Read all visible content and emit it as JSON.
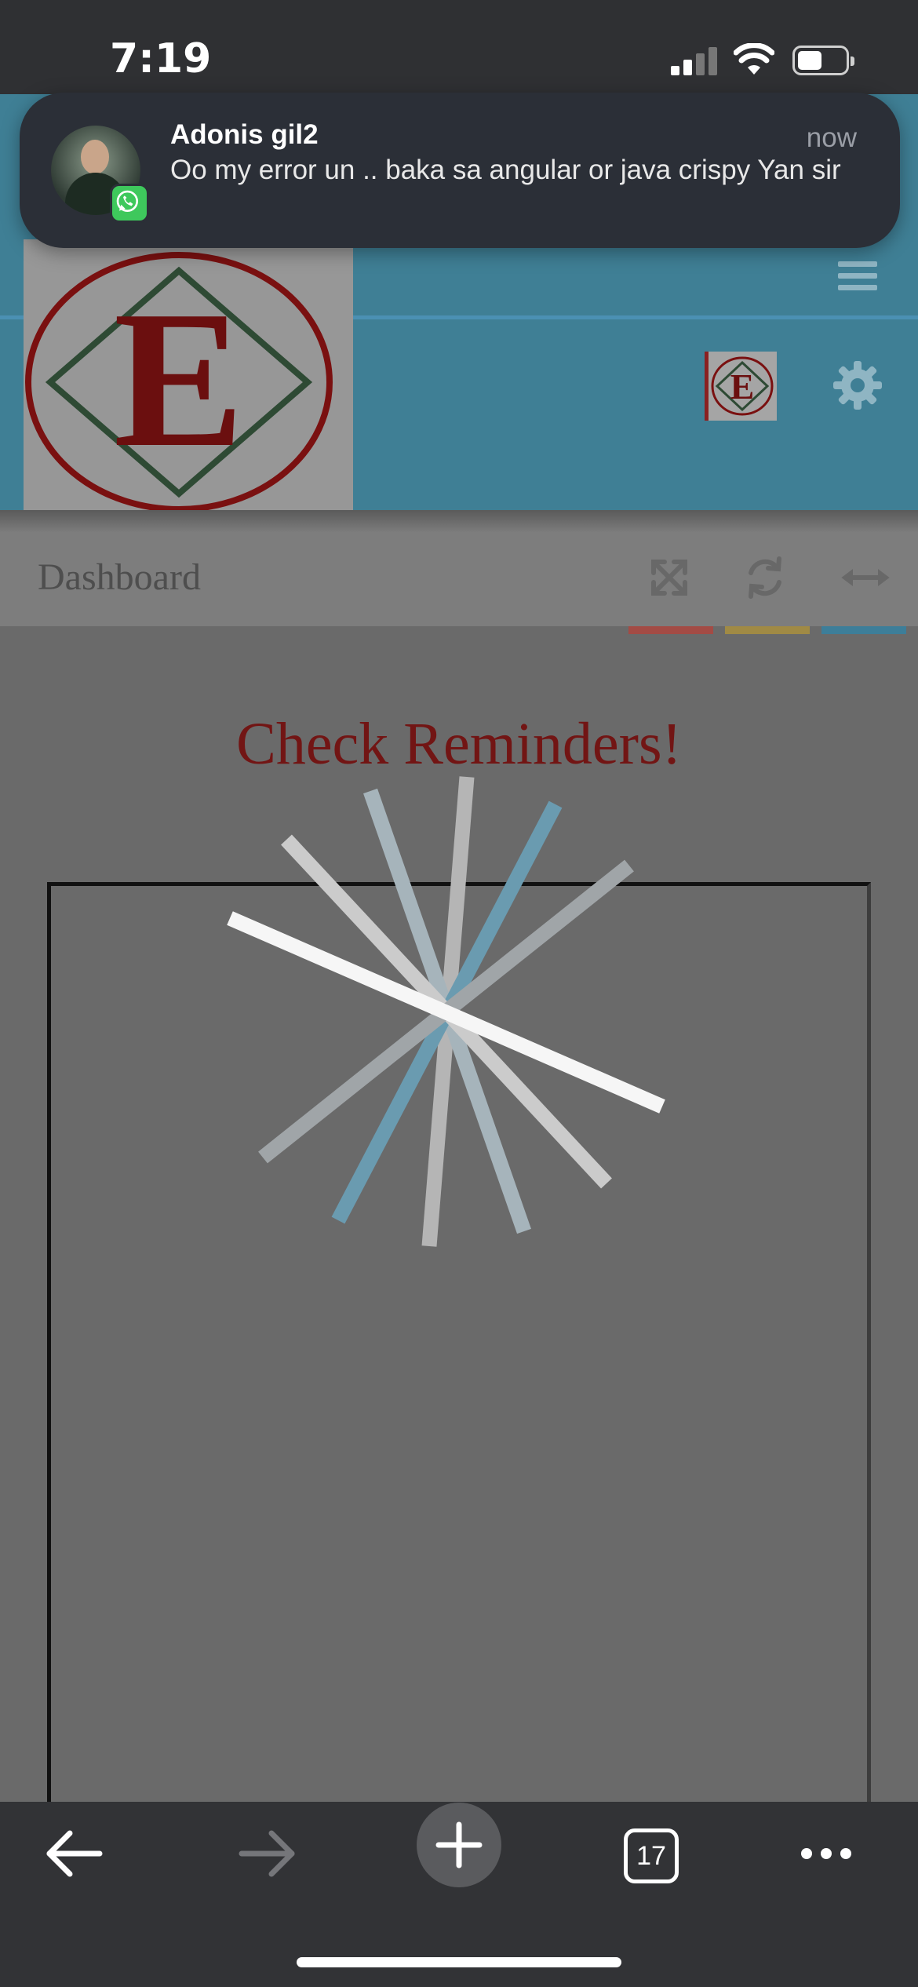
{
  "status_bar": {
    "time": "7:19",
    "battery_level": 0.45
  },
  "notification": {
    "app_icon": "whatsapp-icon",
    "sender": "Adonis gil2",
    "time": "now",
    "message": "Oo my error un .. baka sa angular or java crispy Yan sir"
  },
  "header": {
    "logo_letter": "E",
    "menu_icon": "hamburger-icon",
    "settings_icon": "gear-icon"
  },
  "dashboard": {
    "title": "Dashboard",
    "tools": [
      {
        "name": "expand-icon",
        "accent": "#a34b45"
      },
      {
        "name": "refresh-icon",
        "accent": "#a08a45"
      },
      {
        "name": "resize-horizontal-icon",
        "accent": "#3d7e99"
      }
    ]
  },
  "content": {
    "title": "Check Reminders!"
  },
  "toolbar": {
    "back_icon": "arrow-left-icon",
    "forward_icon": "arrow-right-icon",
    "new_tab_icon": "plus-icon",
    "tab_count": "17",
    "more_icon": "ellipsis-icon"
  },
  "colors": {
    "header_bg": "#3f7f95",
    "logo_red": "#7a1010",
    "logo_green": "#2e4a34",
    "title_red": "#721514"
  }
}
